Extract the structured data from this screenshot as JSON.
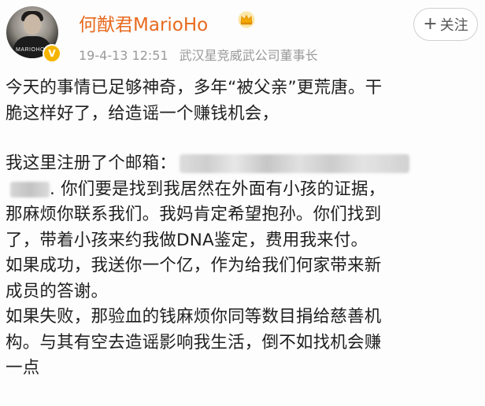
{
  "post": {
    "author": {
      "name": "何猷君MarioHo",
      "avatar_caption": "MARIOHO"
    },
    "time": "19-4-13 12:51",
    "source": "武汉星竞威武公司董事长",
    "follow_label": "关注",
    "lines": [
      "今天的事情已足够神奇，多年“被父亲”更荒唐。干",
      "脆这样好了，给造谣一个赚钱机会，",
      "我这里注册了个邮箱：",
      ". 你们要是找到我居然在外面有小孩的证据，",
      "那麻烦你联系我们。我妈肯定希望抱孙。你们找到",
      "了，带着小孩来约我做DNA鉴定，费用我来付。",
      "如果成功，我送你一个亿，作为给我们何家带来新",
      "成员的答谢。",
      "如果失败，那验血的钱麻烦你同等数目捐给慈善机",
      "构。与其有空去造谣影响我生活，倒不如找机会赚",
      "一点"
    ]
  },
  "colors": {
    "username": "#e86a1f",
    "verified_badge": "#f5b400",
    "meta_text": "#9a9a9a",
    "body_text": "#1f1f1f"
  },
  "icons": {
    "crown": "crown-icon",
    "verified": "verified-badge-icon",
    "follow": "plus-icon"
  }
}
